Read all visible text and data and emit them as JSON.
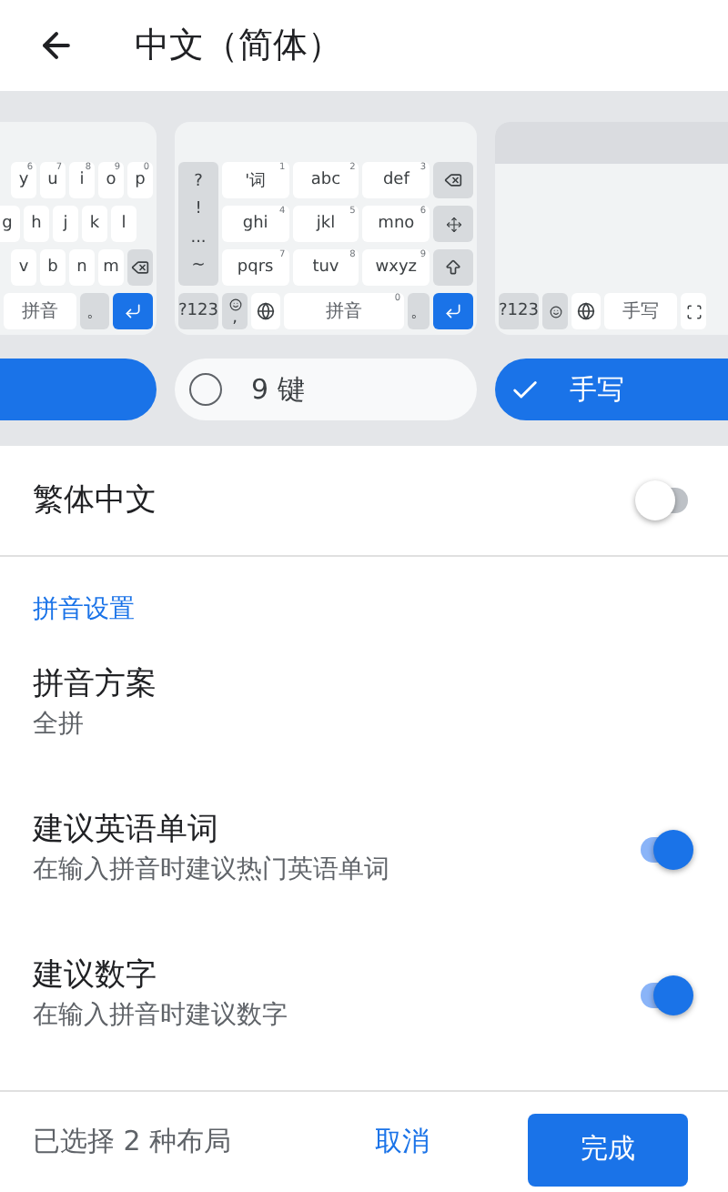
{
  "header": {
    "title": "中文（简体）"
  },
  "layouts": [
    {
      "kind": "qwerty",
      "cut": true,
      "rows": [
        [
          {
            "label": "y",
            "hint": "6"
          },
          {
            "label": "u",
            "hint": "7"
          },
          {
            "label": "i",
            "hint": "8"
          },
          {
            "label": "o",
            "hint": "9"
          },
          {
            "label": "p",
            "hint": "0"
          }
        ],
        [
          {
            "label": "g"
          },
          {
            "label": "h"
          },
          {
            "label": "j"
          },
          {
            "label": "k"
          },
          {
            "label": "l"
          }
        ],
        [
          {
            "label": "v"
          },
          {
            "label": "b"
          },
          {
            "label": "n"
          },
          {
            "label": "m"
          },
          {
            "kind": "backspace"
          }
        ],
        [
          {
            "kind": "space",
            "label": "拼音"
          },
          {
            "kind": "function",
            "label": "。"
          },
          {
            "kind": "enter"
          }
        ]
      ]
    },
    {
      "kind": "t9",
      "side": [
        "?",
        "!",
        "...",
        "~"
      ],
      "rows": [
        [
          {
            "label": "'词",
            "hint": "1"
          },
          {
            "label": "abc",
            "hint": "2"
          },
          {
            "label": "def",
            "hint": "3"
          },
          {
            "kind": "backspace"
          }
        ],
        [
          {
            "label": "ghi",
            "hint": "4"
          },
          {
            "label": "jkl",
            "hint": "5"
          },
          {
            "label": "mno",
            "hint": "6"
          },
          {
            "kind": "move"
          }
        ],
        [
          {
            "label": "pqrs",
            "hint": "7"
          },
          {
            "label": "tuv",
            "hint": "8"
          },
          {
            "label": "wxyz",
            "hint": "9"
          },
          {
            "kind": "shift"
          }
        ],
        [
          {
            "kind": "function",
            "label": "?123"
          },
          {
            "kind": "emoji",
            "label": ","
          },
          {
            "kind": "globe"
          },
          {
            "kind": "space",
            "label": "拼音",
            "hint": "0"
          },
          {
            "kind": "function",
            "label": "。"
          },
          {
            "kind": "enter"
          }
        ]
      ]
    },
    {
      "kind": "handwriting",
      "rows": [
        [
          {
            "kind": "function",
            "label": "?123"
          },
          {
            "kind": "emoji"
          },
          {
            "kind": "globe"
          },
          {
            "kind": "space",
            "label": "手写"
          },
          {
            "kind": "fullscreen"
          }
        ]
      ]
    }
  ],
  "layout_chips": [
    {
      "selected": true,
      "cut": true
    },
    {
      "label": "9 键",
      "selected": false
    },
    {
      "label": "手写",
      "selected": true
    }
  ],
  "settings": [
    {
      "kind": "toggle",
      "title": "繁体中文",
      "on": false
    },
    {
      "kind": "section",
      "title": "拼音设置"
    },
    {
      "kind": "choice",
      "title": "拼音方案",
      "value": "全拼"
    },
    {
      "kind": "toggle",
      "title": "建议英语单词",
      "subtitle": "在输入拼音时建议热门英语单词",
      "on": true
    },
    {
      "kind": "toggle",
      "title": "建议数字",
      "subtitle": "在输入拼音时建议数字",
      "on": true
    }
  ],
  "footer": {
    "status": "已选择 2 种布局",
    "cancel": "取消",
    "confirm": "完成"
  }
}
